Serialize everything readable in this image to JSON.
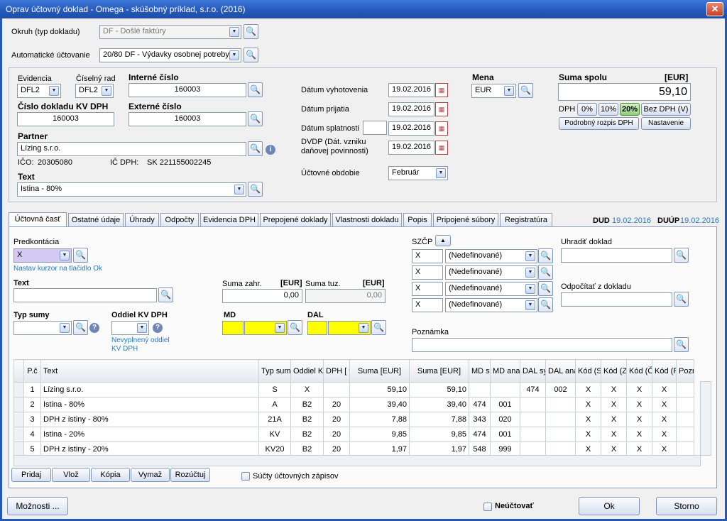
{
  "window": {
    "title": "Oprav účtovný doklad - Omega - skúšobný príklad, s.r.o. (2016)",
    "close": "✕"
  },
  "header": {
    "okruh_label": "Okruh (typ dokladu)",
    "okruh_value": "DF - Došlé faktúry",
    "auto_label": "Automatické účtovanie",
    "auto_value": "20/80 DF - Výdavky osobnej potreby"
  },
  "doc": {
    "evidencia_label": "Evidencia",
    "evidencia_value": "DFL2",
    "ciselny_label": "Číselný rad",
    "ciselny_value": "DFL2",
    "interne_label": "Interné číslo",
    "interne_value": "160003",
    "kvdph_label": "Číslo dokladu KV DPH",
    "kvdph_value": "160003",
    "externe_label": "Externé číslo",
    "externe_value": "160003",
    "partner_label": "Partner",
    "partner_value": "Lízing s.r.o.",
    "ico_label": "IČO:",
    "ico_value": "20305080",
    "icdph_label": "IČ DPH:",
    "icdph_value": "SK 221155002245",
    "text_label": "Text",
    "text_value": "Istina - 80%"
  },
  "dates": {
    "vyhotovenia_label": "Dátum vyhotovenia",
    "vyhotovenia": "19.02.2016",
    "prijatia_label": "Dátum prijatia",
    "prijatia": "19.02.2016",
    "splatnosti_label": "Dátum splatnosti",
    "splatnosti": "19.02.2016",
    "dvdp_label1": "DVDP (Dát. vzniku",
    "dvdp_label2": "daňovej povinnosti)",
    "dvdp": "19.02.2016",
    "obdobie_label": "Účtovné obdobie",
    "obdobie": "Február"
  },
  "mena": {
    "label": "Mena",
    "value": "EUR"
  },
  "suma": {
    "label": "Suma spolu",
    "currency": "[EUR]",
    "value": "59,10",
    "dph_label": "DPH",
    "b0": "0%",
    "b10": "10%",
    "b20": "20%",
    "bez": "Bez DPH (V)",
    "rozpis": "Podrobný rozpis DPH",
    "nastavenie": "Nastavenie"
  },
  "tabs": [
    "Účtovná časť",
    "Ostatné údaje",
    "Úhrady",
    "Odpočty",
    "Evidencia DPH",
    "Prepojené doklady",
    "Vlastnosti dokladu",
    "Popis",
    "Pripojené súbory",
    "Registratúra"
  ],
  "dud": {
    "label": "DUD",
    "value": "19.02.2016",
    "label2": "DUÚP",
    "value2": "19.02.2016"
  },
  "page": {
    "predkontacia_label": "Predkontácia",
    "predkontacia_value": "X",
    "kurzor_hint": "Nastav kurzor na tlačidlo Ok",
    "text_label": "Text",
    "text_value": "",
    "suma_zahr_label": "Suma zahr.",
    "suma_zahr_cur": "[EUR]",
    "suma_zahr": "0,00",
    "suma_tuz_label": "Suma tuz.",
    "suma_tuz_cur": "[EUR]",
    "suma_tuz": "0,00",
    "typ_sumy_label": "Typ sumy",
    "oddiel_label": "Oddiel KV DPH",
    "oddiel_hint1": "Nevyplnený oddiel",
    "oddiel_hint2": "KV DPH",
    "md_label": "MD",
    "dal_label": "DAL",
    "szcp_label": "SZČP",
    "szcp": [
      {
        "code": "X",
        "value": "(Nedefinované)"
      },
      {
        "code": "X",
        "value": "(Nedefinované)"
      },
      {
        "code": "X",
        "value": "(Nedefinované)"
      },
      {
        "code": "X",
        "value": "(Nedefinované)"
      }
    ],
    "uhradit_label": "Uhradiť doklad",
    "odpocitat_label": "Odpočítať z dokladu",
    "poznamka_label": "Poznámka"
  },
  "grid": {
    "columns": [
      "P.č",
      "Text",
      "Typ sumy",
      "Oddiel KV DPH",
      "DPH [ % ]",
      "Suma [EUR]",
      "Suma [EUR]",
      "MD syn",
      "MD anal.",
      "DAL synt.",
      "DAL anal.",
      "Kód (S)",
      "Kód (Z)",
      "Kód (Č)",
      "Kód (P)",
      "Pozná"
    ],
    "rows": [
      [
        "1",
        "Lízing s.r.o.",
        "S",
        "X",
        "",
        "59,10",
        "59,10",
        "",
        "",
        "474",
        "002",
        "X",
        "X",
        "X",
        "X",
        ""
      ],
      [
        "2",
        "Istina - 80%",
        "A",
        "B2",
        "20",
        "39,40",
        "39,40",
        "474",
        "001",
        "",
        "",
        "X",
        "X",
        "X",
        "X",
        ""
      ],
      [
        "3",
        "DPH z istiny - 80%",
        "21A",
        "B2",
        "20",
        "7,88",
        "7,88",
        "343",
        "020",
        "",
        "",
        "X",
        "X",
        "X",
        "X",
        ""
      ],
      [
        "4",
        "Istina - 20%",
        "KV",
        "B2",
        "20",
        "9,85",
        "9,85",
        "474",
        "001",
        "",
        "",
        "X",
        "X",
        "X",
        "X",
        ""
      ],
      [
        "5",
        "DPH z istiny - 20%",
        "KV20",
        "B2",
        "20",
        "1,97",
        "1,97",
        "548",
        "999",
        "",
        "",
        "X",
        "X",
        "X",
        "X",
        ""
      ]
    ]
  },
  "actions": {
    "pridaj": "Pridaj",
    "vloz": "Vlož",
    "kopia": "Kópia",
    "vymaz": "Vymaž",
    "rozuctuj": "Rozúčtuj",
    "sucty": "Súčty účtovných zápisov"
  },
  "footer": {
    "moznosti": "Možnosti ...",
    "neuctovat": "Neúčtovať",
    "ok": "Ok",
    "storno": "Storno"
  }
}
